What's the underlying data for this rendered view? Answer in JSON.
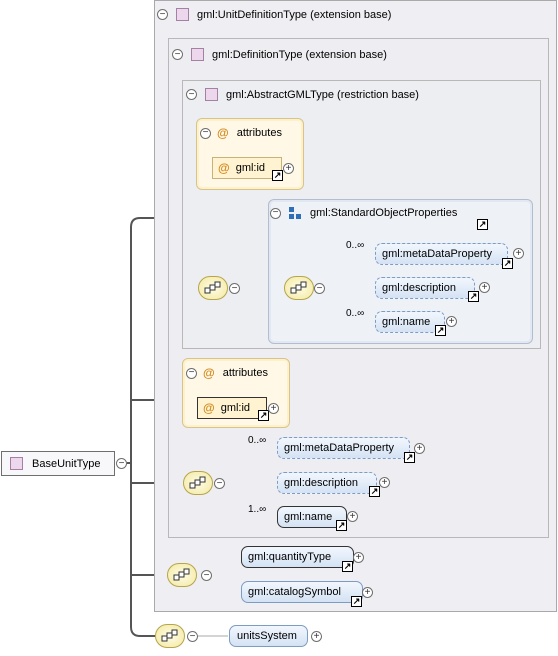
{
  "root": {
    "label": "BaseUnitType"
  },
  "frames": {
    "unitdef": {
      "label": "gml:UnitDefinitionType (extension base)"
    },
    "definition": {
      "label": "gml:DefinitionType (extension base)"
    },
    "abstractgml": {
      "label": "gml:AbstractGMLType (restriction base)"
    }
  },
  "attributes_inner": {
    "label": "attributes",
    "field": "gml:id"
  },
  "attributes_outer": {
    "label": "attributes",
    "field": "gml:id"
  },
  "std_group": {
    "label": "gml:StandardObjectProperties",
    "items": [
      {
        "label": "gml:metaDataProperty",
        "cardinality": "0..∞"
      },
      {
        "label": "gml:description",
        "cardinality": ""
      },
      {
        "label": "gml:name",
        "cardinality": "0..∞"
      }
    ]
  },
  "definition_seq": {
    "items": [
      {
        "label": "gml:metaDataProperty",
        "cardinality": "0..∞"
      },
      {
        "label": "gml:description",
        "cardinality": ""
      },
      {
        "label": "gml:name",
        "cardinality": "1..∞"
      }
    ]
  },
  "unit_choice": {
    "items": [
      {
        "label": "gml:quantityType"
      },
      {
        "label": "gml:catalogSymbol"
      }
    ]
  },
  "units_system": {
    "label": "unitsSystem"
  },
  "colors": {
    "frame_bg": "#efeff3",
    "element_fill": "#d4e2f4",
    "attribute_fill": "#fff3d2",
    "compositor_fill": "#f2e8a0",
    "type_icon": "#ecd7ec"
  }
}
